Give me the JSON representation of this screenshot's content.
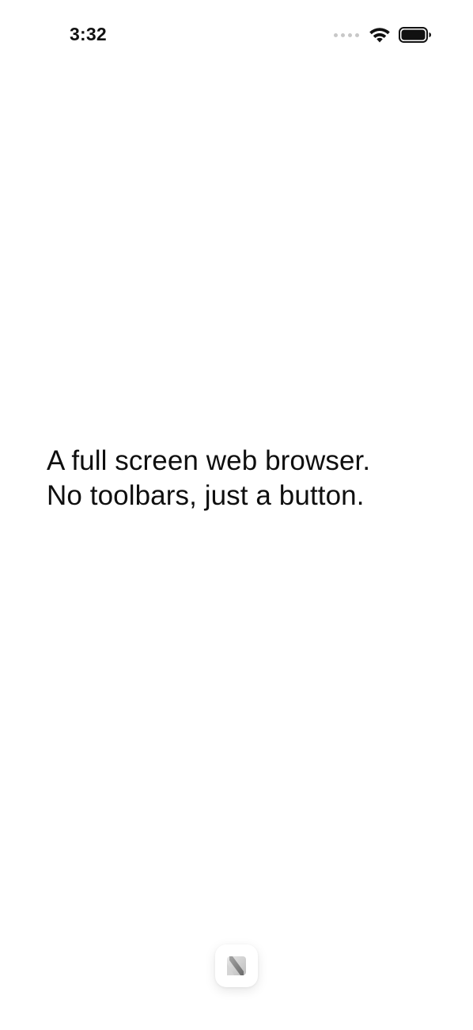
{
  "status_bar": {
    "time": "3:32",
    "icons": [
      "cellular-signal-icon",
      "wifi-icon",
      "battery-icon"
    ]
  },
  "content": {
    "line1": "A full screen web browser.",
    "line2": "No toolbars, just a button."
  },
  "floating_button": {
    "icon": "browser-logo-icon"
  },
  "colors": {
    "background": "#ffffff",
    "text": "#0f0f0f",
    "signal_dots": "#c8c8c8"
  }
}
